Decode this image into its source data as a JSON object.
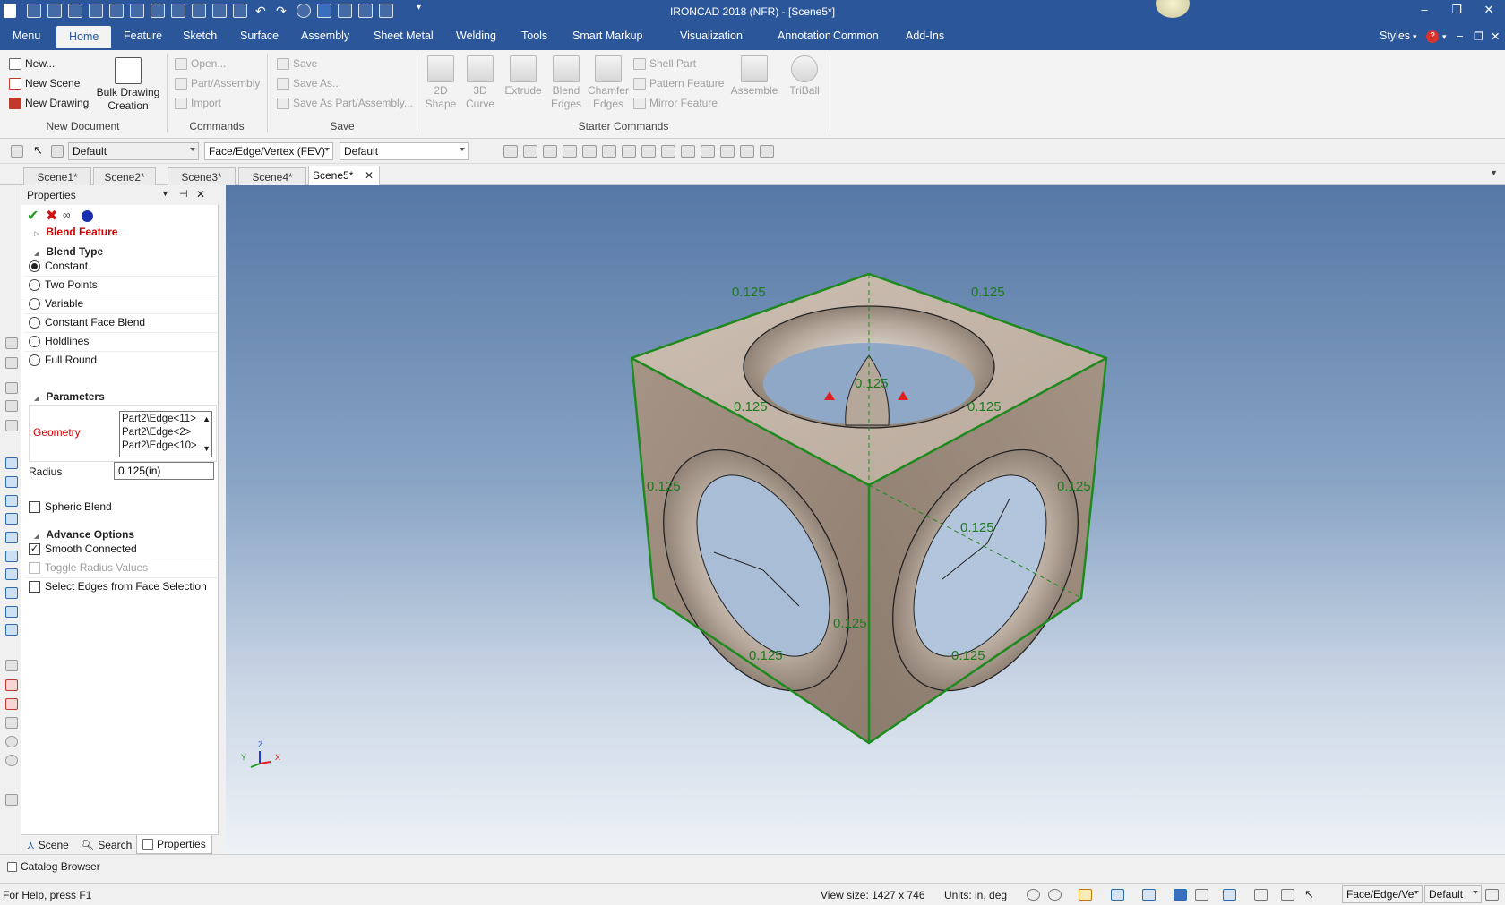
{
  "app": {
    "title": "IRONCAD 2018 (NFR) - [Scene5*]"
  },
  "menubar": {
    "items": [
      "Menu",
      "Home",
      "Feature",
      "Sketch",
      "Surface",
      "Assembly",
      "Sheet Metal",
      "Welding",
      "Tools",
      "Smart Markup",
      "Visualization",
      "Annotation",
      "Common",
      "Add-Ins"
    ],
    "active": "Home",
    "styles_label": "Styles"
  },
  "ribbon": {
    "new_document": {
      "new": "New...",
      "new_scene": "New Scene",
      "new_drawing": "New Drawing",
      "bulk_line1": "Bulk Drawing",
      "bulk_line2": "Creation",
      "label": "New Document"
    },
    "commands": {
      "open": "Open...",
      "part_assembly": "Part/Assembly",
      "import": "Import",
      "label": "Commands"
    },
    "save": {
      "save": "Save",
      "save_as": "Save As...",
      "save_as_part": "Save As Part/Assembly...",
      "label": "Save"
    },
    "starter": {
      "shape_line1": "2D",
      "shape_line2": "Shape",
      "curve_line1": "3D",
      "curve_line2": "Curve",
      "extrude": "Extrude",
      "blend_line1": "Blend",
      "blend_line2": "Edges",
      "chamfer_line1": "Chamfer",
      "chamfer_line2": "Edges",
      "shell": "Shell Part",
      "pattern": "Pattern Feature",
      "mirror": "Mirror Feature",
      "assemble": "Assemble",
      "triball": "TriBall",
      "label": "Starter Commands"
    }
  },
  "toolbar": {
    "combo1": "Default",
    "combo2": "Face/Edge/Vertex (FEV)",
    "combo3": "Default"
  },
  "tabs": [
    "Scene1*",
    "Scene2*",
    "Scene3*",
    "Scene4*",
    "Scene5*"
  ],
  "active_tab": "Scene5*",
  "properties": {
    "title": "Properties",
    "feature_title": "Blend Feature",
    "blend_type_header": "Blend Type",
    "blend_types": [
      "Constant",
      "Two Points",
      "Variable",
      "Constant Face Blend",
      "Holdlines",
      "Full Round"
    ],
    "selected_blend_type": "Constant",
    "parameters_header": "Parameters",
    "geometry_label": "Geometry",
    "geometry_items": [
      "Part2\\Edge<11>",
      "Part2\\Edge<2>",
      "Part2\\Edge<10>"
    ],
    "radius_label": "Radius",
    "radius_value": "0.125(in)",
    "spheric_blend": "Spheric Blend",
    "advance_header": "Advance Options",
    "smooth_connected": "Smooth Connected",
    "toggle_radius": "Toggle Radius Values",
    "select_edges": "Select Edges from Face Selection"
  },
  "panel_tabs": {
    "scene": "Scene",
    "search": "Search",
    "properties": "Properties"
  },
  "viewport": {
    "dimension_label": "0.125",
    "axis_x": "X",
    "axis_y": "Y",
    "axis_z": "Z"
  },
  "catalog": {
    "label": "Catalog Browser"
  },
  "status": {
    "help": "For Help, press F1",
    "view_size": "View size: 1427 x  746",
    "units": "Units: in, deg",
    "combo1": "Face/Edge/Ve",
    "combo2": "Default"
  },
  "colors": {
    "accent": "#2b579a",
    "edge_highlight": "#1e8a1e",
    "feature_title": "#d00000"
  }
}
